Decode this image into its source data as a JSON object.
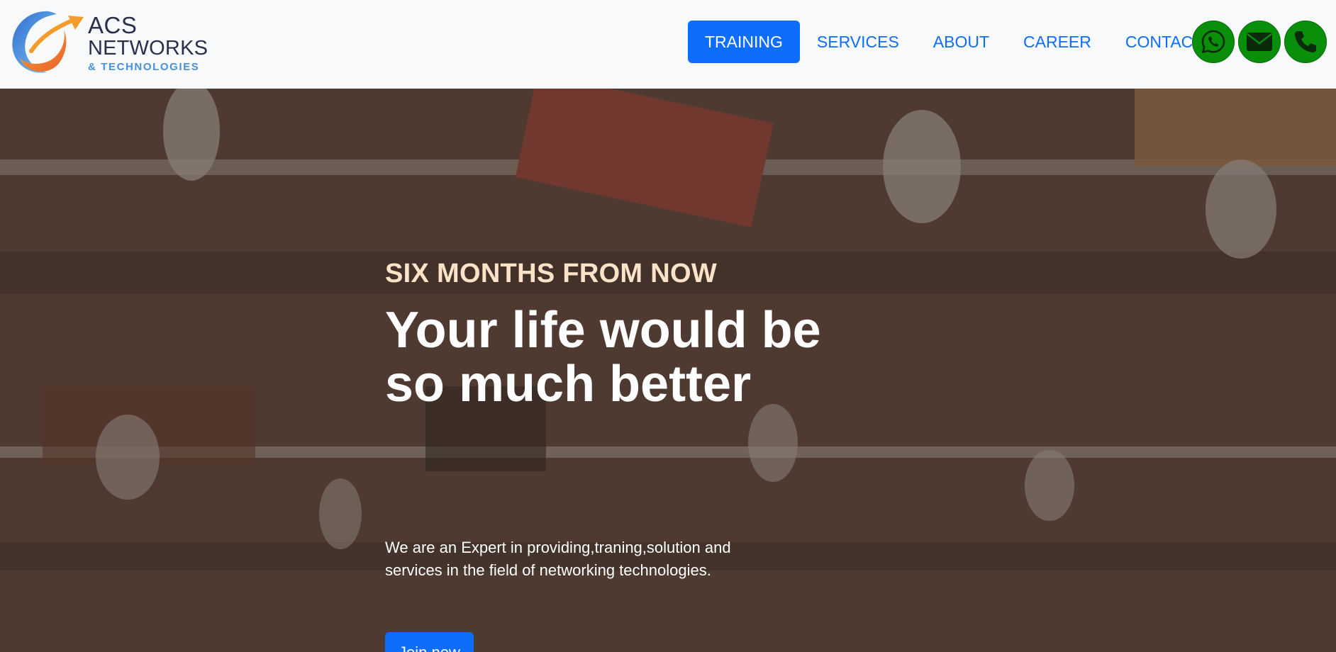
{
  "brand": {
    "line1": "ACS",
    "line2": "NETWORKS",
    "line3": "& TECHNOLOGIES"
  },
  "nav": {
    "items": [
      {
        "label": "TRAINING",
        "active": true
      },
      {
        "label": "SERVICES",
        "active": false
      },
      {
        "label": "ABOUT",
        "active": false
      },
      {
        "label": "CAREER",
        "active": false
      },
      {
        "label": "CONTACT",
        "active": false
      }
    ],
    "contact_icons": [
      "whatsapp-icon",
      "email-icon",
      "phone-icon"
    ],
    "accent_color": "#0d6efd",
    "contact_color": "#0a8f0a"
  },
  "hero": {
    "eyebrow": "SIX MONTHS FROM NOW",
    "title_line1": "Your life would be",
    "title_line2": "so much better",
    "description": "We are an Expert in providing,traning,solution and services in the field of networking technologies.",
    "cta_label": "Join now"
  }
}
